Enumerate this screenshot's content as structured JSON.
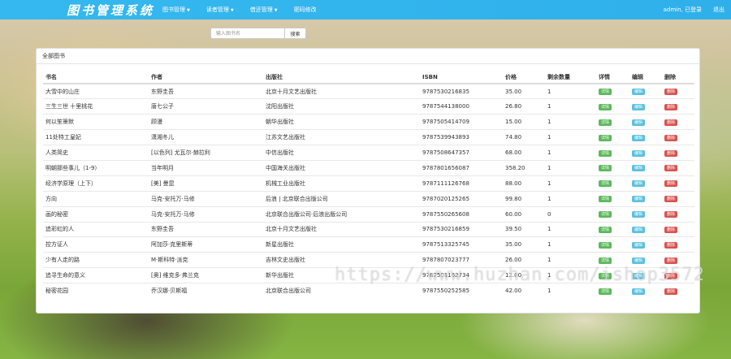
{
  "navbar": {
    "brand": "图书管理系统",
    "menu": [
      {
        "label": "图书管理",
        "caret": "▼"
      },
      {
        "label": "读者管理",
        "caret": "▼"
      },
      {
        "label": "借还管理",
        "caret": "▼"
      },
      {
        "label": "密码修改",
        "caret": ""
      }
    ],
    "user_status": "admin, 已登录",
    "logout": "退出"
  },
  "search": {
    "placeholder": "输入图书名",
    "button": "搜索"
  },
  "panel": {
    "title": "全部图书"
  },
  "table": {
    "headers": [
      "书名",
      "作者",
      "出版社",
      "ISBN",
      "价格",
      "剩余数量",
      "详情",
      "编辑",
      "删除"
    ],
    "action_labels": {
      "detail": "详情",
      "edit": "编辑",
      "delete": "删除"
    },
    "rows": [
      {
        "title": "大雪中的山庄",
        "author": "东野圭吾",
        "publisher": "北京十月文艺出版社",
        "isbn": "9787530216835",
        "price": "35.00",
        "remaining": "1"
      },
      {
        "title": "三生三世 十里桃花",
        "author": "唐七公子",
        "publisher": "沈阳出版社",
        "isbn": "9787544138000",
        "price": "26.80",
        "remaining": "1"
      },
      {
        "title": "何以笙箫默",
        "author": "顾漫",
        "publisher": "朝华出版社",
        "isbn": "9787505414709",
        "price": "15.00",
        "remaining": "1"
      },
      {
        "title": "11处特工皇妃",
        "author": "潇湘冬儿",
        "publisher": "江苏文艺出版社",
        "isbn": "9787539943893",
        "price": "74.80",
        "remaining": "1"
      },
      {
        "title": "人类简史",
        "author": "[以色列] 尤瓦尔·赫拉利",
        "publisher": "中信出版社",
        "isbn": "9787508647357",
        "price": "68.00",
        "remaining": "1"
      },
      {
        "title": "明朝那些事儿（1-9）",
        "author": "当年明月",
        "publisher": "中国海关出版社",
        "isbn": "9787801656087",
        "price": "358.20",
        "remaining": "1"
      },
      {
        "title": "经济学原理（上下）",
        "author": "[美] 曼昆",
        "publisher": "机械工业出版社",
        "isbn": "9787111126768",
        "price": "88.00",
        "remaining": "1"
      },
      {
        "title": "方向",
        "author": "马克-安托万·马修",
        "publisher": "后浪 | 北京联合出版公司",
        "isbn": "9787020125265",
        "price": "99.80",
        "remaining": "1"
      },
      {
        "title": "画的秘密",
        "author": "马克-安托万·马修",
        "publisher": "北京联合出版公司·后浪出版公司",
        "isbn": "9787550265608",
        "price": "60.00",
        "remaining": "0"
      },
      {
        "title": "追彩虹的人",
        "author": "东野圭吾",
        "publisher": "北京十月文艺出版社",
        "isbn": "9787530216859",
        "price": "39.50",
        "remaining": "1"
      },
      {
        "title": "控方证人",
        "author": "阿加莎·克里斯蒂",
        "publisher": "新星出版社",
        "isbn": "9787513325745",
        "price": "35.00",
        "remaining": "1"
      },
      {
        "title": "少有人走的路",
        "author": "M·斯科特·派克",
        "publisher": "吉林文史出版社",
        "isbn": "9787807023777",
        "price": "26.00",
        "remaining": "1"
      },
      {
        "title": "追寻生命的意义",
        "author": "[奥] 维克多·弗兰克",
        "publisher": "新华出版社",
        "isbn": "9787501162734",
        "price": "12.00",
        "remaining": "1"
      },
      {
        "title": "秘密花园",
        "author": "乔汉娜·贝斯福",
        "publisher": "北京联合出版公司",
        "isbn": "9787550252585",
        "price": "42.00",
        "remaining": "1"
      }
    ]
  },
  "watermark": "https://www.huzhan.com/ishop3572"
}
